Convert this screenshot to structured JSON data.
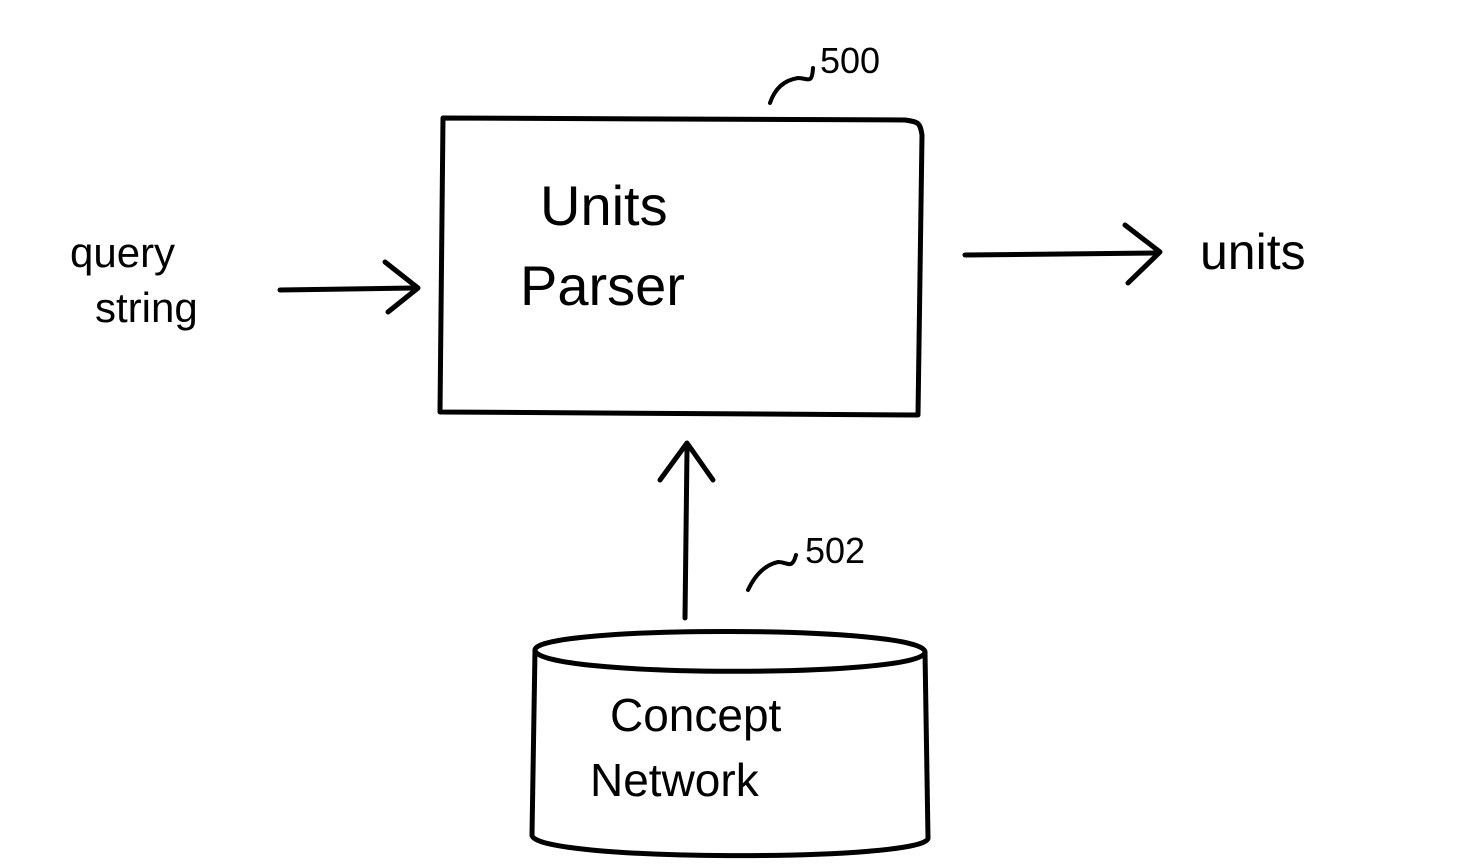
{
  "diagram": {
    "input_label_line1": "query",
    "input_label_line2": "string",
    "box": {
      "title_line1": "Units",
      "title_line2": "Parser",
      "callout_number": "500"
    },
    "output_label": "units",
    "cylinder": {
      "title_line1": "Concept",
      "title_line2": "Network",
      "callout_number": "502"
    }
  }
}
